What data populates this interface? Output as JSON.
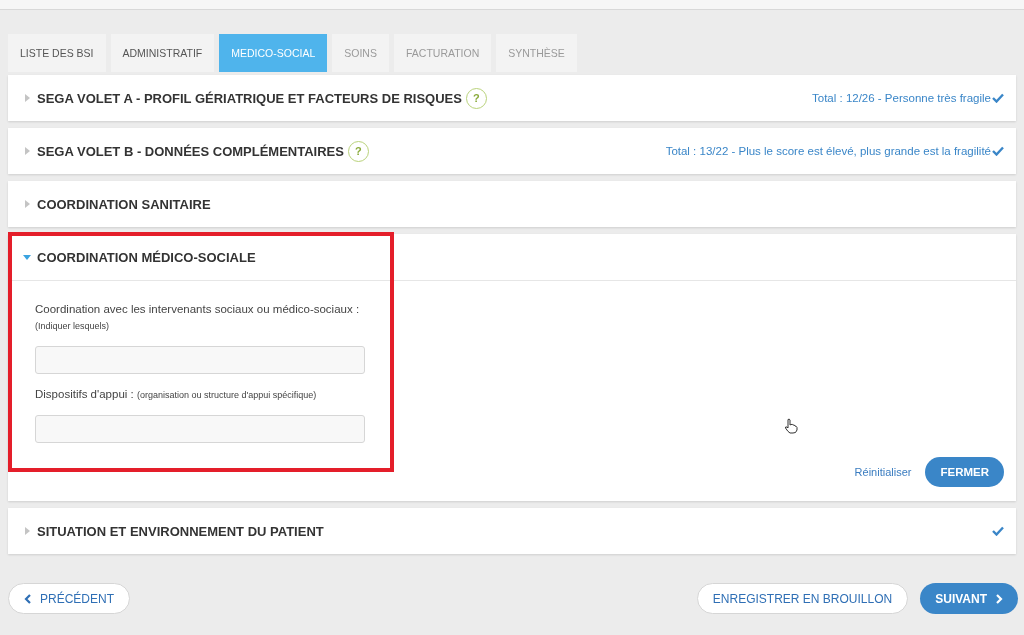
{
  "tabs": [
    {
      "label": "LISTE DES BSI",
      "selected": false,
      "disabled": false
    },
    {
      "label": "ADMINISTRATIF",
      "selected": false,
      "disabled": false
    },
    {
      "label": "MEDICO-SOCIAL",
      "selected": true,
      "disabled": false
    },
    {
      "label": "SOINS",
      "selected": false,
      "disabled": true
    },
    {
      "label": "FACTURATION",
      "selected": false,
      "disabled": true
    },
    {
      "label": "SYNTHÈSE",
      "selected": false,
      "disabled": true
    }
  ],
  "sections": [
    {
      "title": "SEGA VOLET A - PROFIL GÉRIATRIQUE ET FACTEURS DE RISQUES",
      "help": "?",
      "summary": "Total : 12/26 - Personne très fragile",
      "checked": true,
      "expanded": false,
      "highlighted": false
    },
    {
      "title": "SEGA VOLET B - DONNÉES COMPLÉMENTAIRES",
      "help": "?",
      "summary": "Total : 13/22 - Plus le score est élevé, plus grande est la fragilité",
      "checked": true,
      "expanded": false,
      "highlighted": false
    },
    {
      "title": "COORDINATION SANITAIRE",
      "checked": false,
      "expanded": false,
      "highlighted": false
    },
    {
      "title": "COORDINATION MÉDICO-SOCIALE",
      "checked": false,
      "expanded": true,
      "highlighted": true,
      "fields": [
        {
          "label": "Coordination avec les intervenants sociaux ou médico-sociaux :",
          "hint": "(Indiquer lesquels)",
          "hint_inline": false
        },
        {
          "label": "Dispositifs d'appui :",
          "hint": "(organisation ou structure d'appui spécifique)",
          "hint_inline": true
        }
      ],
      "reset": "Réinitialiser",
      "close": "FERMER"
    },
    {
      "title": "SITUATION ET ENVIRONNEMENT DU PATIENT",
      "checked": true,
      "expanded": false,
      "highlighted": false
    }
  ],
  "footer": {
    "previous": "PRÉCÉDENT",
    "draft": "ENREGISTRER EN BROUILLON",
    "next": "SUIVANT"
  }
}
